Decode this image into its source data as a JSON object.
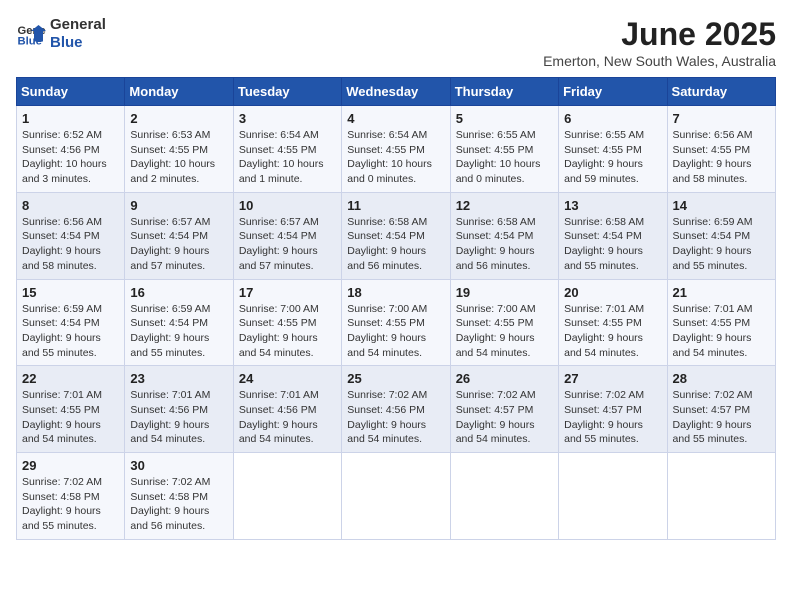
{
  "header": {
    "logo_general": "General",
    "logo_blue": "Blue",
    "title": "June 2025",
    "subtitle": "Emerton, New South Wales, Australia"
  },
  "weekdays": [
    "Sunday",
    "Monday",
    "Tuesday",
    "Wednesday",
    "Thursday",
    "Friday",
    "Saturday"
  ],
  "weeks": [
    [
      {
        "day": 1,
        "sunrise": "6:52 AM",
        "sunset": "4:56 PM",
        "daylight": "10 hours and 3 minutes."
      },
      {
        "day": 2,
        "sunrise": "6:53 AM",
        "sunset": "4:55 PM",
        "daylight": "10 hours and 2 minutes."
      },
      {
        "day": 3,
        "sunrise": "6:54 AM",
        "sunset": "4:55 PM",
        "daylight": "10 hours and 1 minute."
      },
      {
        "day": 4,
        "sunrise": "6:54 AM",
        "sunset": "4:55 PM",
        "daylight": "10 hours and 0 minutes."
      },
      {
        "day": 5,
        "sunrise": "6:55 AM",
        "sunset": "4:55 PM",
        "daylight": "10 hours and 0 minutes."
      },
      {
        "day": 6,
        "sunrise": "6:55 AM",
        "sunset": "4:55 PM",
        "daylight": "9 hours and 59 minutes."
      },
      {
        "day": 7,
        "sunrise": "6:56 AM",
        "sunset": "4:55 PM",
        "daylight": "9 hours and 58 minutes."
      }
    ],
    [
      {
        "day": 8,
        "sunrise": "6:56 AM",
        "sunset": "4:54 PM",
        "daylight": "9 hours and 58 minutes."
      },
      {
        "day": 9,
        "sunrise": "6:57 AM",
        "sunset": "4:54 PM",
        "daylight": "9 hours and 57 minutes."
      },
      {
        "day": 10,
        "sunrise": "6:57 AM",
        "sunset": "4:54 PM",
        "daylight": "9 hours and 57 minutes."
      },
      {
        "day": 11,
        "sunrise": "6:58 AM",
        "sunset": "4:54 PM",
        "daylight": "9 hours and 56 minutes."
      },
      {
        "day": 12,
        "sunrise": "6:58 AM",
        "sunset": "4:54 PM",
        "daylight": "9 hours and 56 minutes."
      },
      {
        "day": 13,
        "sunrise": "6:58 AM",
        "sunset": "4:54 PM",
        "daylight": "9 hours and 55 minutes."
      },
      {
        "day": 14,
        "sunrise": "6:59 AM",
        "sunset": "4:54 PM",
        "daylight": "9 hours and 55 minutes."
      }
    ],
    [
      {
        "day": 15,
        "sunrise": "6:59 AM",
        "sunset": "4:54 PM",
        "daylight": "9 hours and 55 minutes."
      },
      {
        "day": 16,
        "sunrise": "6:59 AM",
        "sunset": "4:54 PM",
        "daylight": "9 hours and 55 minutes."
      },
      {
        "day": 17,
        "sunrise": "7:00 AM",
        "sunset": "4:55 PM",
        "daylight": "9 hours and 54 minutes."
      },
      {
        "day": 18,
        "sunrise": "7:00 AM",
        "sunset": "4:55 PM",
        "daylight": "9 hours and 54 minutes."
      },
      {
        "day": 19,
        "sunrise": "7:00 AM",
        "sunset": "4:55 PM",
        "daylight": "9 hours and 54 minutes."
      },
      {
        "day": 20,
        "sunrise": "7:01 AM",
        "sunset": "4:55 PM",
        "daylight": "9 hours and 54 minutes."
      },
      {
        "day": 21,
        "sunrise": "7:01 AM",
        "sunset": "4:55 PM",
        "daylight": "9 hours and 54 minutes."
      }
    ],
    [
      {
        "day": 22,
        "sunrise": "7:01 AM",
        "sunset": "4:55 PM",
        "daylight": "9 hours and 54 minutes."
      },
      {
        "day": 23,
        "sunrise": "7:01 AM",
        "sunset": "4:56 PM",
        "daylight": "9 hours and 54 minutes."
      },
      {
        "day": 24,
        "sunrise": "7:01 AM",
        "sunset": "4:56 PM",
        "daylight": "9 hours and 54 minutes."
      },
      {
        "day": 25,
        "sunrise": "7:02 AM",
        "sunset": "4:56 PM",
        "daylight": "9 hours and 54 minutes."
      },
      {
        "day": 26,
        "sunrise": "7:02 AM",
        "sunset": "4:57 PM",
        "daylight": "9 hours and 54 minutes."
      },
      {
        "day": 27,
        "sunrise": "7:02 AM",
        "sunset": "4:57 PM",
        "daylight": "9 hours and 55 minutes."
      },
      {
        "day": 28,
        "sunrise": "7:02 AM",
        "sunset": "4:57 PM",
        "daylight": "9 hours and 55 minutes."
      }
    ],
    [
      {
        "day": 29,
        "sunrise": "7:02 AM",
        "sunset": "4:58 PM",
        "daylight": "9 hours and 55 minutes."
      },
      {
        "day": 30,
        "sunrise": "7:02 AM",
        "sunset": "4:58 PM",
        "daylight": "9 hours and 56 minutes."
      },
      null,
      null,
      null,
      null,
      null
    ]
  ]
}
